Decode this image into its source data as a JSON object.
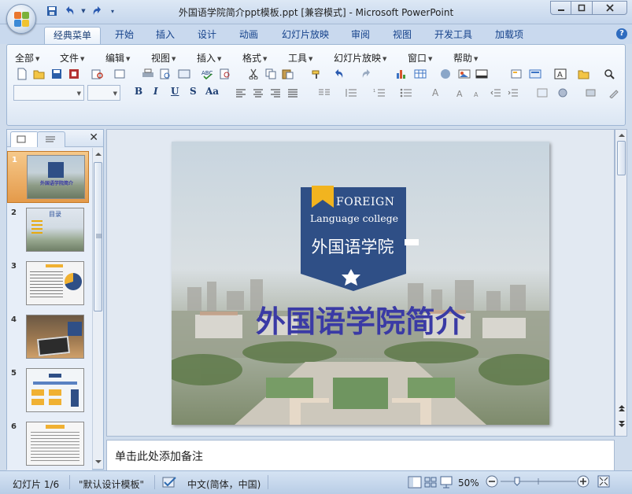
{
  "window": {
    "title": "外国语学院简介ppt模板.ppt [兼容模式] - Microsoft PowerPoint",
    "controls": [
      "minimize-icon",
      "restore-icon",
      "close-icon"
    ]
  },
  "ribbon_tabs": [
    "经典菜单",
    "开始",
    "插入",
    "设计",
    "动画",
    "幻灯片放映",
    "审阅",
    "视图",
    "开发工具",
    "加载项"
  ],
  "menu": [
    "全部",
    "文件",
    "编辑",
    "视图",
    "插入",
    "格式",
    "工具",
    "幻灯片放映",
    "窗口",
    "帮助"
  ],
  "format_buttons": [
    "B",
    "I",
    "U",
    "S",
    "Aa"
  ],
  "slide": {
    "badge_line1": "FOREIGN",
    "badge_line2": "Language college",
    "badge_cn": "外国语学院",
    "title": "外国语学院简介",
    "colors": {
      "badge": "#2f4f86",
      "title": "#3a3aa5",
      "ribbon": "#f2b41f"
    }
  },
  "thumbnails": [
    {
      "num": "1",
      "label": "外国语学院简介"
    },
    {
      "num": "2",
      "label": "目录"
    },
    {
      "num": "3",
      "label": ""
    },
    {
      "num": "4",
      "label": ""
    },
    {
      "num": "5",
      "label": ""
    },
    {
      "num": "6",
      "label": ""
    }
  ],
  "notes_placeholder": "单击此处添加备注",
  "status": {
    "slide_info": "幻灯片 1/6",
    "theme": "\"默认设计模板\"",
    "language": "中文(简体，中国)",
    "zoom": "50%"
  }
}
